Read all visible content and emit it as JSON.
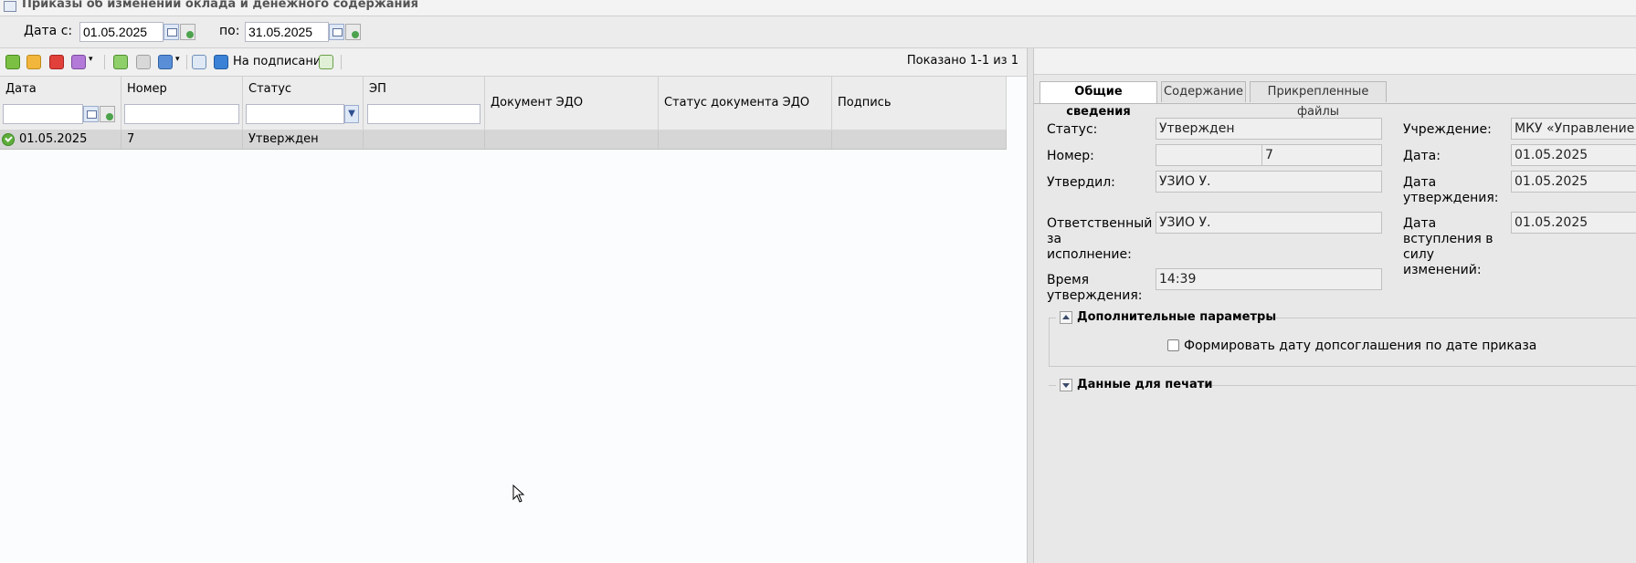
{
  "window": {
    "title": "Приказы об изменении оклада и денежного содержания"
  },
  "filter": {
    "date_from_label": "Дата с:",
    "date_from_value": "01.05.2025",
    "date_to_label": "по:",
    "date_to_value": "31.05.2025"
  },
  "toolbar": {
    "icons": [
      "add-icon",
      "edit-icon",
      "delete-icon",
      "settings-icon",
      "approve-icon",
      "check-icon",
      "print-icon",
      "export-icon",
      "signing-icon",
      "refresh-icon"
    ],
    "sign_label": "На подписание",
    "paging_text": "Показано 1-1 из 1"
  },
  "grid": {
    "columns": [
      "Дата",
      "Номер",
      "Статус",
      "ЭП",
      "Документ ЭДО",
      "Статус документа ЭДО",
      "Подпись"
    ],
    "rows": [
      {
        "date": "01.05.2025",
        "number": "7",
        "status": "Утвержден",
        "ep": "",
        "edo_doc": "",
        "edo_status": "",
        "signature": ""
      }
    ]
  },
  "details": {
    "tabs": [
      "Общие сведения",
      "Содержание",
      "Прикрепленные файлы"
    ],
    "status_label": "Статус:",
    "status_value": "Утвержден",
    "institution_label": "Учреждение:",
    "institution_value": "МКУ «Управление зем",
    "number_label": "Номер:",
    "number_prefix": "",
    "number_value": "7",
    "date_label": "Дата:",
    "date_value": "01.05.2025",
    "approved_by_label": "Утвердил:",
    "approved_by_value": "УЗИО У.",
    "approval_date_label": "Дата утверждения:",
    "approval_date_value": "01.05.2025",
    "responsible_label": "Ответственный за исполнение:",
    "responsible_value": "УЗИО У.",
    "effective_date_label": "Дата вступления в силу изменений:",
    "effective_date_value": "01.05.2025",
    "approval_time_label": "Время утверждения:",
    "approval_time_value": "14:39",
    "extra_params_title": "Дополнительные параметры",
    "extra_checkbox_label": "Формировать дату допсоглашения по дате приказа",
    "extra_checkbox_checked": false,
    "print_data_title": "Данные для печати"
  },
  "colors": {
    "selected_row": "#d6d6d6",
    "panel_bg": "#e8e8e8",
    "field_bg": "#efefef"
  }
}
